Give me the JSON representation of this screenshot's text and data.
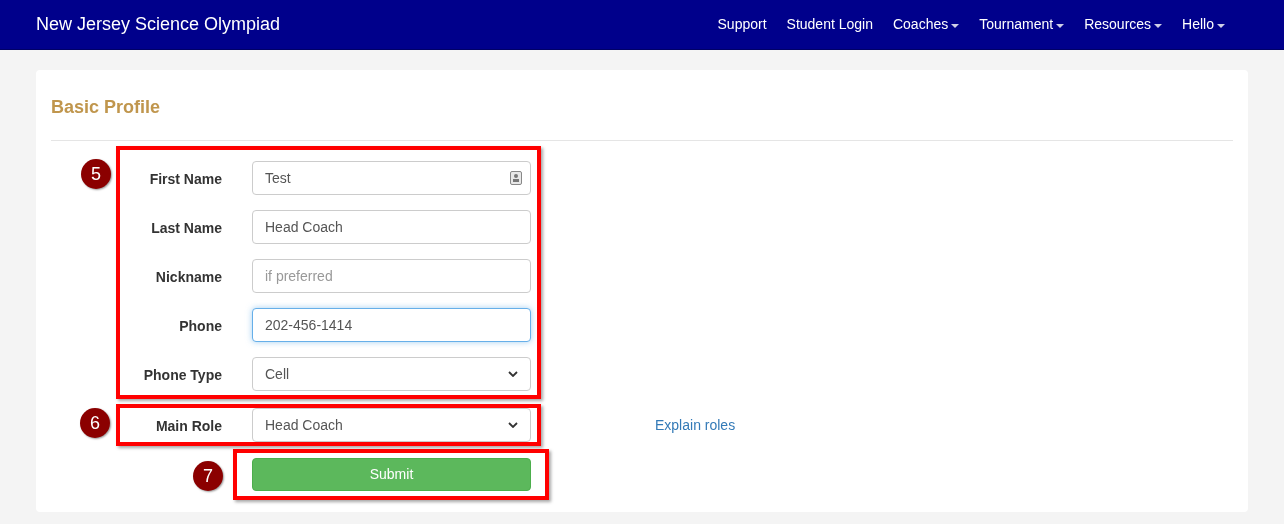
{
  "navbar": {
    "brand": "New Jersey Science Olympiad",
    "items": [
      {
        "label": "Support",
        "dropdown": false
      },
      {
        "label": "Student Login",
        "dropdown": false
      },
      {
        "label": "Coaches",
        "dropdown": true
      },
      {
        "label": "Tournament",
        "dropdown": true
      },
      {
        "label": "Resources",
        "dropdown": true
      },
      {
        "label": "Hello",
        "dropdown": true
      }
    ]
  },
  "card": {
    "title": "Basic Profile"
  },
  "sections": [
    {
      "callout": "5",
      "fields": [
        {
          "label": "First Name",
          "kind": "text",
          "value": "Test",
          "focused": false,
          "autofill": true
        },
        {
          "label": "Last Name",
          "kind": "text",
          "value": "Head Coach",
          "focused": false,
          "autofill": false
        },
        {
          "label": "Nickname",
          "kind": "text",
          "placeholder": "if preferred",
          "focused": false,
          "autofill": false
        },
        {
          "label": "Phone",
          "kind": "text",
          "value": "202-456-1414",
          "focused": true,
          "autofill": false
        },
        {
          "label": "Phone Type",
          "kind": "select",
          "value": "Cell",
          "focused": false
        }
      ]
    },
    {
      "callout": "6",
      "fields": [
        {
          "label": "Main Role",
          "kind": "select",
          "value": "Head Coach",
          "focused": false
        }
      ],
      "link": "Explain roles"
    }
  ],
  "submit": {
    "callout": "7",
    "label": "Submit"
  }
}
